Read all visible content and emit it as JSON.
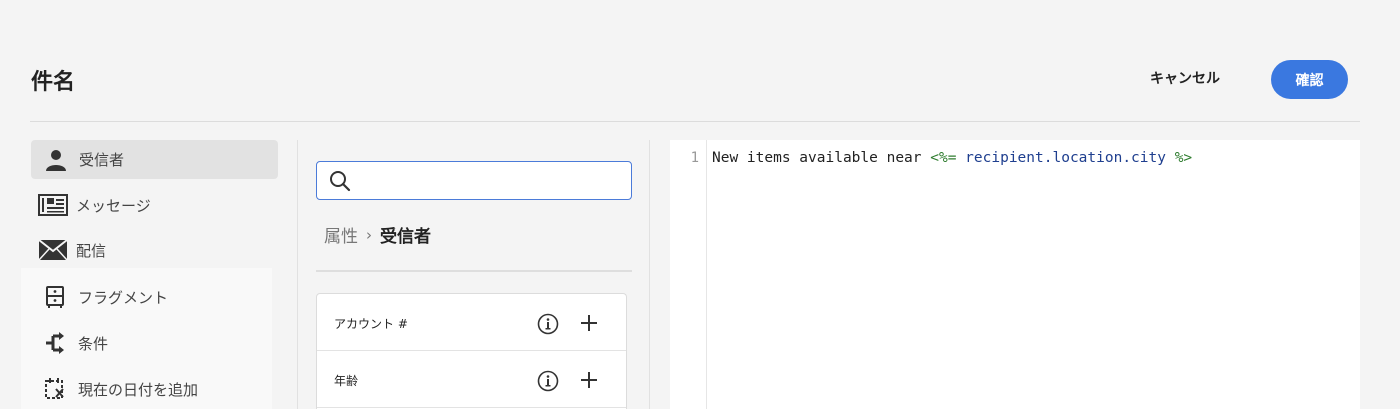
{
  "header": {
    "title": "件名",
    "cancel_label": "キャンセル",
    "confirm_label": "確認"
  },
  "sidebar": {
    "items": [
      {
        "label": "受信者",
        "icon": "user-icon"
      },
      {
        "label": "メッセージ",
        "icon": "newspaper-icon"
      },
      {
        "label": "配信",
        "icon": "envelope-icon"
      },
      {
        "label": "フラグメント",
        "icon": "fragment-icon"
      },
      {
        "label": "条件",
        "icon": "branch-icon"
      },
      {
        "label": "現在の日付を追加",
        "icon": "calendar-add-icon"
      }
    ]
  },
  "search": {
    "value": "",
    "placeholder": ""
  },
  "breadcrumb": {
    "parent": "属性",
    "current": "受信者"
  },
  "attributes": [
    {
      "label": "アカウント #"
    },
    {
      "label": "年齢"
    }
  ],
  "editor": {
    "line_number": "1",
    "text_prefix": "New items available near ",
    "tag_open": "<%=",
    "expression": " recipient.location.city ",
    "tag_close": "%>"
  },
  "colors": {
    "accent": "#3a78e0",
    "tag": "#2f7d2f",
    "variable": "#1f3f8f"
  }
}
